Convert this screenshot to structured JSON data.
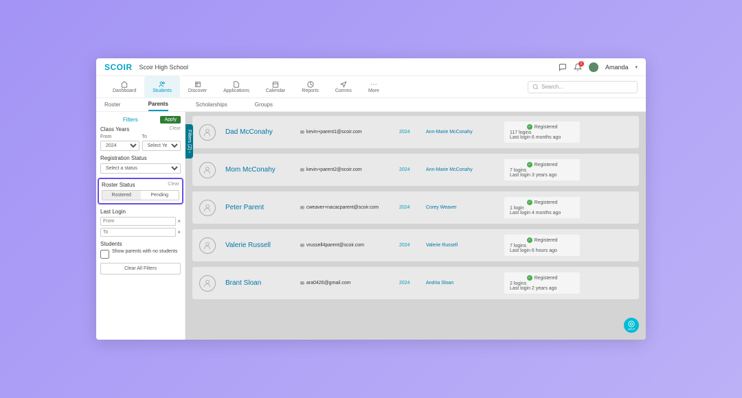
{
  "header": {
    "logo": "SCOIR",
    "school": "Scoir High School",
    "notif_count": "1",
    "user_name": "Amanda"
  },
  "nav": {
    "items": [
      "Dashboard",
      "Students",
      "Discover",
      "Applications",
      "Calendar",
      "Reports",
      "Comms",
      "More"
    ],
    "active": 1,
    "search_placeholder": "Search..."
  },
  "subnav": {
    "items": [
      "Roster",
      "Parents",
      "Scholarships",
      "Groups"
    ],
    "active": 1
  },
  "filters": {
    "label": "Filters",
    "apply": "Apply",
    "class_years": {
      "title": "Class Years",
      "clear": "Clear",
      "from_label": "From",
      "to_label": "To",
      "from_value": "2024",
      "to_value": "Select Year"
    },
    "registration": {
      "title": "Registration Status",
      "placeholder": "Select a status"
    },
    "roster": {
      "title": "Roster Status",
      "clear": "Clear",
      "opt1": "Rostered",
      "opt2": "Pending"
    },
    "last_login": {
      "title": "Last Login",
      "from_ph": "From",
      "to_ph": "To"
    },
    "students": {
      "title": "Students",
      "checkbox_label": "Show parents with no students"
    },
    "clear_all": "Clear All Filters",
    "tab_label": "Filters (2)"
  },
  "parents": [
    {
      "name": "Dad McConahy",
      "email": "kevin+parent1@scoir.com",
      "year": "2024",
      "student": "Ann-Marie McConahy",
      "status": "Registered",
      "logins": "117 logins",
      "last": "Last login 6 months ago"
    },
    {
      "name": "Mom McConahy",
      "email": "kevin+parent2@scoir.com",
      "year": "2024",
      "student": "Ann-Marie McConahy",
      "status": "Registered",
      "logins": "7 logins",
      "last": "Last login 3 years ago"
    },
    {
      "name": "Peter Parent",
      "email": "cweaver+nacacparent@scoir.com",
      "year": "2024",
      "student": "Corey Weaver",
      "status": "Registered",
      "logins": "1 login",
      "last": "Last login 4 months ago"
    },
    {
      "name": "Valerie Russell",
      "email": "vrussell4parent@scoir.com",
      "year": "2024",
      "student": "Valerie Russell",
      "status": "Registered",
      "logins": "7 logins",
      "last": "Last login 6 hours ago"
    },
    {
      "name": "Brant Sloan",
      "email": "ara0426@gmail.com",
      "year": "2024",
      "student": "Andria Sloan",
      "status": "Registered",
      "logins": "2 logins",
      "last": "Last login 2 years ago"
    }
  ],
  "help": "HELP"
}
